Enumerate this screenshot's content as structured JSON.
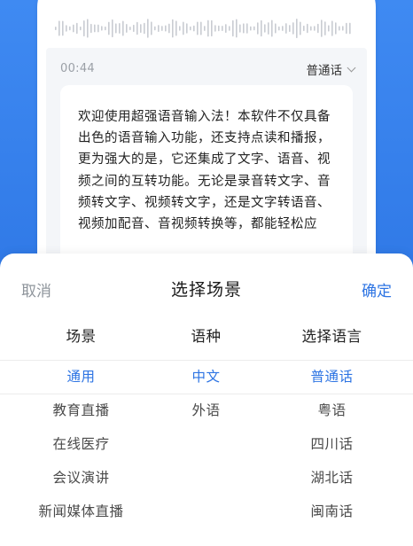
{
  "background_color": "#3a84ef",
  "accent_color": "#2d74e3",
  "recorder": {
    "time": "00:44",
    "language": "普通话",
    "transcript": "欢迎使用超强语音输入法！本软件不仅具备出色的语音输入功能，还支持点读和播报，更为强大的是，它还集成了文字、语音、视频之间的互转功能。无论是录音转文字、音频转文字、视频转文字，还是文字转语音、视频加配音、音视频转换等，都能轻松应"
  },
  "sheet": {
    "cancel_label": "取消",
    "title": "选择场景",
    "confirm_label": "确定",
    "columns": [
      {
        "header": "场景",
        "options": [
          "通用",
          "教育直播",
          "在线医疗",
          "会议演讲",
          "新闻媒体直播"
        ],
        "selected_index": 0
      },
      {
        "header": "语种",
        "options": [
          "中文",
          "外语"
        ],
        "selected_index": 0
      },
      {
        "header": "选择语言",
        "options": [
          "普通话",
          "粤语",
          "四川话",
          "湖北话",
          "闽南话"
        ],
        "selected_index": 0
      }
    ]
  }
}
